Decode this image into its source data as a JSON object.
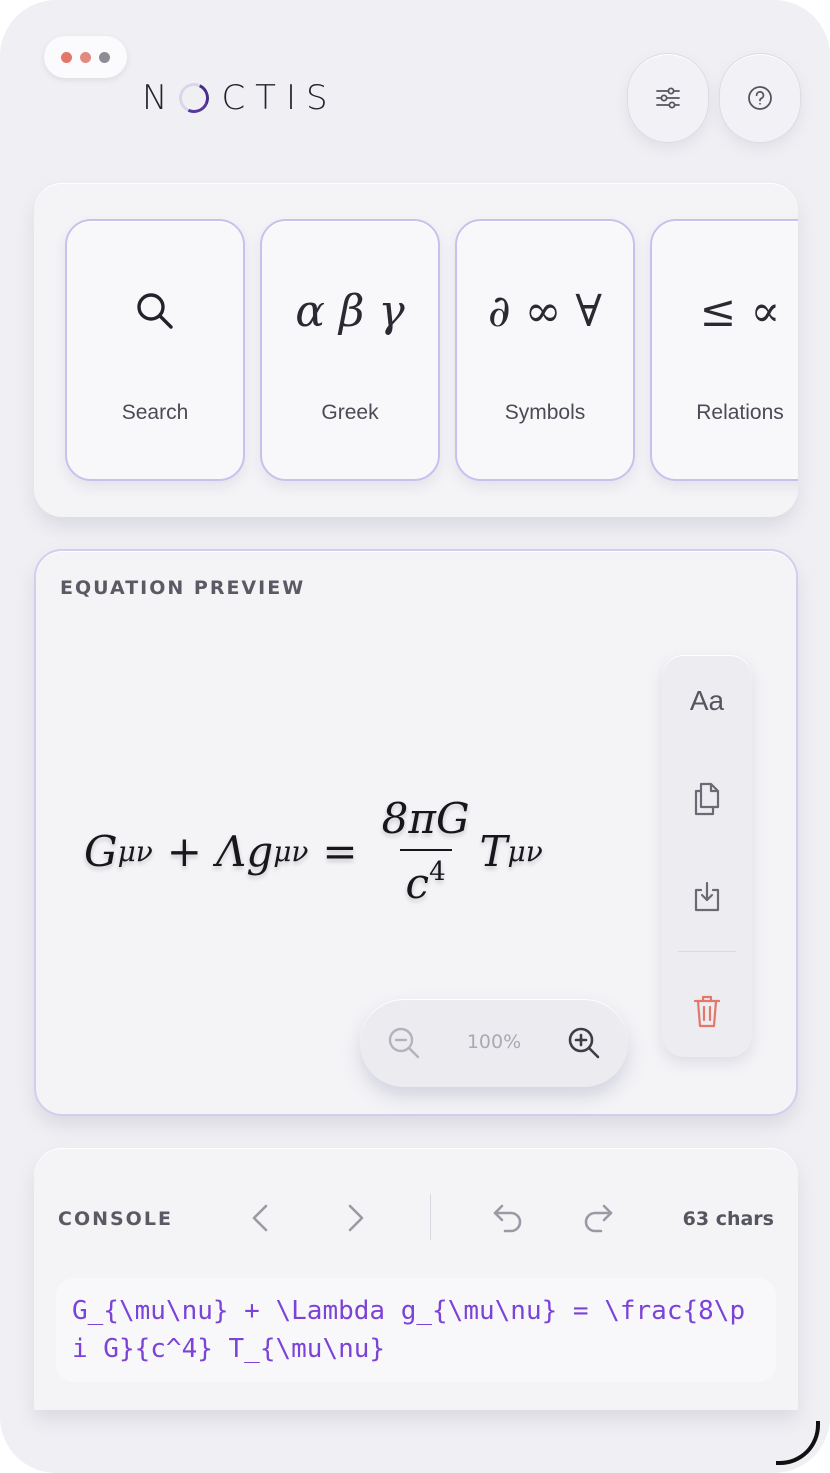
{
  "app": {
    "logo": "NOCTIS",
    "logo_parts": [
      "N",
      "CTIS"
    ]
  },
  "window_dots": {
    "colors": [
      "#e2776a",
      "#e38a80",
      "#8d8d95"
    ]
  },
  "header": {
    "filters_icon": "sliders-icon",
    "help_icon": "help-circle-icon"
  },
  "tools": [
    {
      "label": "Search",
      "icon": "search-icon"
    },
    {
      "label": "Greek",
      "glyph": "α β γ"
    },
    {
      "label": "Symbols",
      "glyph": "∂ ∞ ∀"
    },
    {
      "label": "Relations",
      "glyph": "≤ ∝"
    }
  ],
  "preview": {
    "title": "EQUATION PREVIEW",
    "equation": {
      "lhs_g": "G",
      "lhs_sub": "μν",
      "plus": "+",
      "lambda": "Λg",
      "lambda_sub": "μν",
      "equals": "=",
      "numerator": "8πG",
      "denominator": "c",
      "denominator_exp": "4",
      "rhs": "T",
      "rhs_sub": "μν"
    },
    "side_tools": {
      "font_label": "Aa",
      "copy_icon": "copy-icon",
      "download_icon": "download-icon",
      "delete_icon": "trash-icon"
    },
    "zoom": {
      "level": "100%",
      "zoom_out_icon": "zoom-out-icon",
      "zoom_in_icon": "zoom-in-icon"
    }
  },
  "console": {
    "title": "CONSOLE",
    "char_count": "63 chars",
    "code": "G_{\\mu\\nu} + \\Lambda g_{\\mu\\nu} = \\frac{8\\pi G}{c^4} T_{\\mu\\nu}"
  },
  "colors": {
    "accent": "#7b43d6",
    "card_border": "#cbbfee",
    "delete": "#e2776a"
  }
}
